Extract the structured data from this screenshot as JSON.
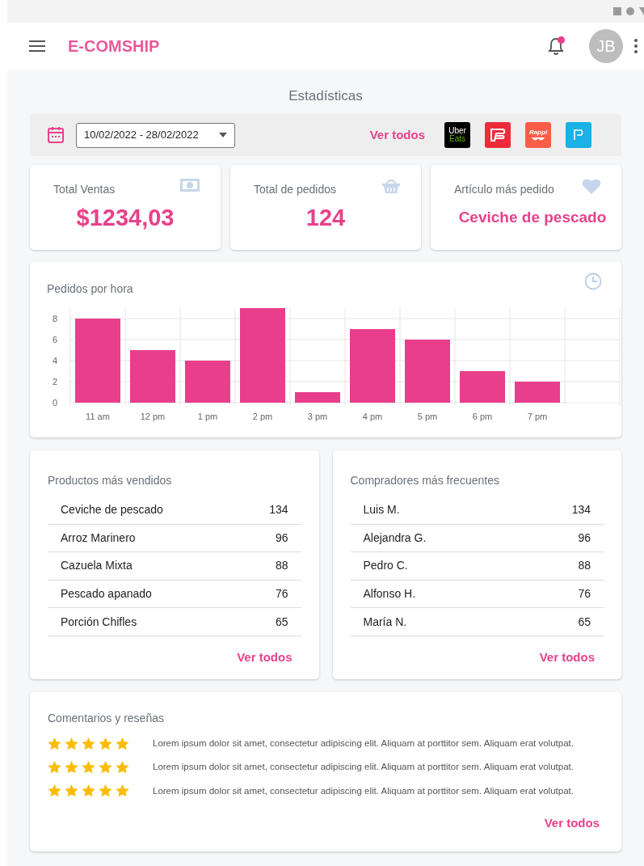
{
  "app": {
    "title": "E-COMSHIP",
    "avatar": "JB",
    "notifications": true
  },
  "page_title": "Estadísticas",
  "filter": {
    "date_range": "10/02/2022 - 28/02/2022",
    "link": "Ver todos",
    "platforms": [
      {
        "kind": "uber",
        "text": [
          "Uber",
          "Eats"
        ]
      },
      {
        "kind": "hand"
      },
      {
        "kind": "rappi",
        "text": [
          "Rappi"
        ]
      },
      {
        "kind": "picker"
      }
    ]
  },
  "stats": [
    {
      "kind": "money",
      "label": "Total Ventas",
      "value": "$1234,03"
    },
    {
      "kind": "basket",
      "label": "Total de pedidos",
      "value": "124"
    },
    {
      "kind": "heart",
      "label": "Artículo más pedido",
      "value": "Ceviche de pescado"
    }
  ],
  "orders_chart": {
    "title": "Pedidos por hora",
    "chart_data": {
      "type": "bar",
      "categories": [
        "11 am",
        "12 pm",
        "1 pm",
        "2 pm",
        "3 pm",
        "4 pm",
        "5 pm",
        "6 pm",
        "7 pm"
      ],
      "series": [
        {
          "color": "#e83e8c",
          "values": [
            8,
            5,
            4,
            9,
            1,
            7,
            6,
            3,
            2
          ]
        }
      ],
      "ylim": [
        0,
        9
      ],
      "yticks": [
        0,
        2,
        4,
        6,
        8
      ],
      "grid": true
    }
  },
  "top_products": {
    "title": "Productos más vendidos",
    "rows": [
      {
        "name": "Ceviche de pescado",
        "count": "134"
      },
      {
        "name": "Arroz Marinero",
        "count": "96"
      },
      {
        "name": "Cazuela Mixta",
        "count": "88"
      },
      {
        "name": "Pescado apanado",
        "count": "76"
      },
      {
        "name": "Porción Chifles",
        "count": "65"
      }
    ],
    "link": "Ver todos"
  },
  "top_buyers": {
    "title": "Compradores más frecuentes",
    "rows": [
      {
        "name": "Luis M.",
        "count": "134"
      },
      {
        "name": "Alejandra G.",
        "count": "96"
      },
      {
        "name": "Pedro C.",
        "count": "88"
      },
      {
        "name": "Alfonso H.",
        "count": "76"
      },
      {
        "name": "María N.",
        "count": "65"
      }
    ],
    "link": "Ver todos"
  },
  "reviews": {
    "title": "Comentarios y reseñas",
    "items": [
      {
        "stars": 5,
        "text": "Lorem ipsum dolor sit amet, consectetur adipiscing elit. Aliquam at porttitor sem. Aliquam erat volutpat."
      },
      {
        "stars": 5,
        "text": "Lorem ipsum dolor sit amet, consectetur adipiscing elit. Aliquam at porttitor sem. Aliquam erat volutpat."
      },
      {
        "stars": 5,
        "text": "Lorem ipsum dolor sit amet, consectetur adipiscing elit. Aliquam at porttitor sem. Aliquam erat volutpat."
      }
    ],
    "link": "Ver todos"
  }
}
